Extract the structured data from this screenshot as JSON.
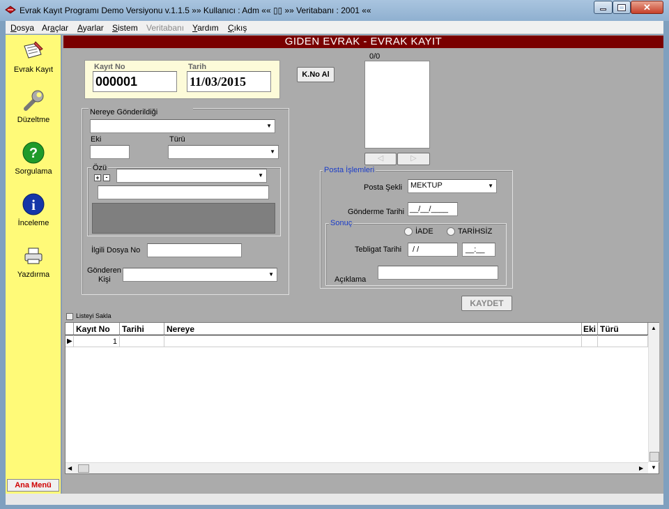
{
  "window": {
    "title": "Evrak Kayıt Programı Demo Versiyonu   v.1.1.5 »»  Kullanıcı : Adm ««    ▯▯    »»  Veritabanı : 2001 ««",
    "min_icon": "minimize-icon",
    "max_icon": "maximize-icon",
    "close_icon": "close-icon"
  },
  "menu": [
    {
      "u": "D",
      "rest": "osya"
    },
    {
      "u": "A",
      "rest": "raçlar",
      "pre": "",
      "label": "Araçlar"
    },
    {
      "u": "A",
      "rest": "yarlar"
    },
    {
      "u": "S",
      "rest": "istem"
    },
    {
      "u": "",
      "rest": "Veritabanı"
    },
    {
      "u": "Y",
      "rest": "ardım"
    },
    {
      "u": "Ç",
      "rest": "ıkış"
    }
  ],
  "sidebar": {
    "items": [
      {
        "label": "Evrak Kayıt",
        "icon": "document-edit-icon"
      },
      {
        "label": "Düzeltme",
        "icon": "wrench-icon"
      },
      {
        "label": "Sorgulama",
        "icon": "question-icon"
      },
      {
        "label": "İnceleme",
        "icon": "info-icon"
      },
      {
        "label": "Yazdırma",
        "icon": "printer-icon"
      }
    ],
    "ana_menu": "Ana Menü"
  },
  "header": "GIDEN EVRAK - EVRAK KAYIT",
  "form": {
    "kayit_no_label": "Kayıt No",
    "kayit_no_value": "000001",
    "tarih_label": "Tarih",
    "tarih_value": "11/03/2015",
    "kno_button": "K.No Al",
    "counter": "0/0",
    "nereye_label": "Nereye Gönderildiği",
    "eki_label": "Eki",
    "turu_label": "Türü",
    "ozu_label": "Özü",
    "plus": "+",
    "minus": "-",
    "ilgili_label": "İlgili  Dosya No",
    "gonderen_label_1": "Gönderen",
    "gonderen_label_2": "Kişi"
  },
  "posta": {
    "group_label": "Posta İşlemleri",
    "posta_sekli_label": "Posta Şekli",
    "posta_sekli_value": "MEKTUP",
    "gonderme_tarihi_label": "Gönderme Tarihi",
    "gonderme_tarihi_value": "__/__/____",
    "sonuc_label": "Sonuç",
    "iade_label": "İADE",
    "tarihsiz_label": "TARİHSİZ",
    "tebligat_label": "Tebligat Tarihi",
    "tebligat_value": " / /",
    "saat_value": "__:__",
    "aciklama_label": "Açıklama"
  },
  "kaydet_button": "KAYDET",
  "listeyi_sakla": "Listeyi Sakla",
  "grid": {
    "columns": [
      "Kayıt No",
      "Tarihi",
      "Nereye",
      "Eki",
      "Türü"
    ],
    "rows": [
      {
        "kayit_no": "1",
        "tarihi": "",
        "nereye": "",
        "eki": "",
        "turu": ""
      }
    ]
  }
}
